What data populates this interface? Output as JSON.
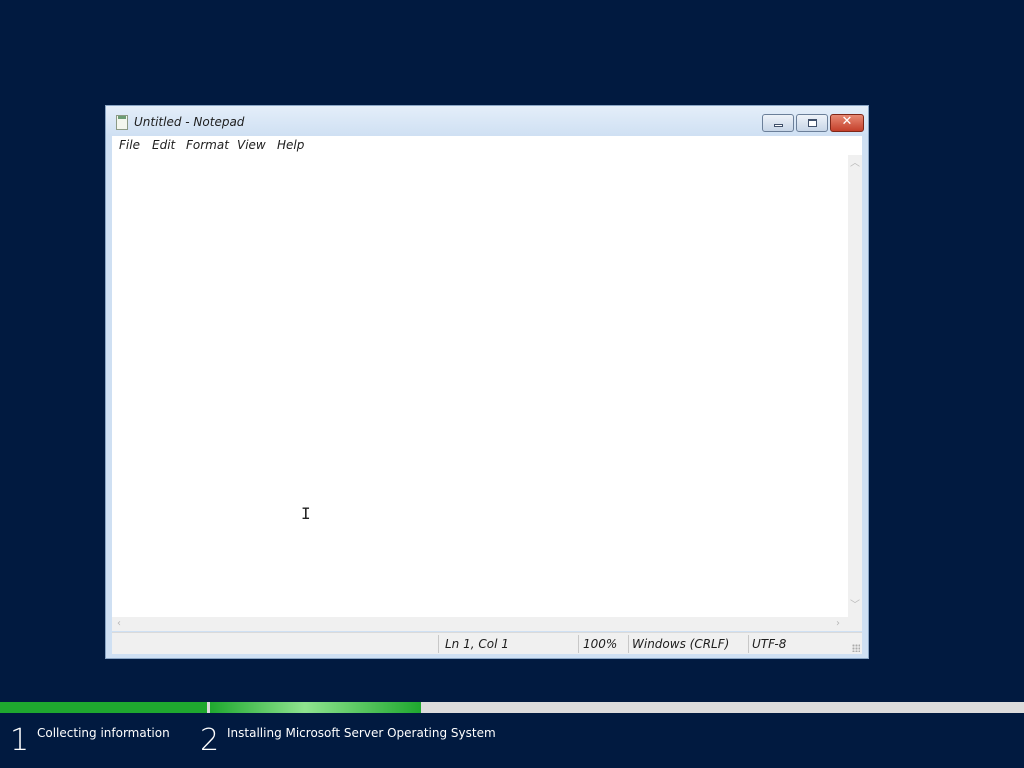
{
  "window": {
    "title": "Untitled - Notepad",
    "app_icon": "notepad-icon",
    "caption_buttons": {
      "minimize_icon": "minimize-icon",
      "maximize_icon": "maximize-icon",
      "close_icon": "close-icon",
      "close_glyph": "✕"
    }
  },
  "menu": {
    "items": [
      {
        "label": "File"
      },
      {
        "label": "Edit"
      },
      {
        "label": "Format"
      },
      {
        "label": "View"
      },
      {
        "label": "Help"
      }
    ]
  },
  "editor": {
    "content": "",
    "cursor_glyph": "I"
  },
  "scrollbars": {
    "up_glyph": "︿",
    "down_glyph": "﹀",
    "left_glyph": "‹",
    "right_glyph": "›"
  },
  "statusbar": {
    "position": "Ln 1, Col 1",
    "zoom": "100%",
    "line_ending": "Windows (CRLF)",
    "encoding": "UTF-8"
  },
  "setup": {
    "steps": [
      {
        "number": "1",
        "label": "Collecting information",
        "progress": 1.0
      },
      {
        "number": "2",
        "label": "Installing Microsoft Server Operating System",
        "progress": 0.26
      }
    ],
    "colors": {
      "background": "#011a40",
      "progress_fill": "#1fa82f",
      "progress_track": "#dcdcdc"
    }
  }
}
